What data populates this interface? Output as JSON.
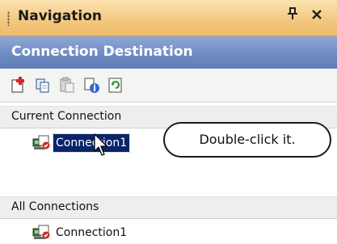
{
  "titlebar": {
    "title": "Navigation",
    "pin_icon": "⚲",
    "close_icon": "✕"
  },
  "destination_header": {
    "title": "Connection Destination"
  },
  "toolbar": {
    "icons": [
      "new-connection-icon",
      "copy-icon",
      "paste-icon",
      "properties-icon",
      "refresh-icon"
    ]
  },
  "current_connection": {
    "header": "Current Connection",
    "item": {
      "label": "Connection1",
      "selected": true,
      "icon": "connection-icon"
    }
  },
  "all_connections": {
    "header": "All Connections",
    "items": [
      {
        "label": "Connection1",
        "icon": "connection-icon"
      }
    ]
  },
  "callout": {
    "text": "Double-click it."
  },
  "colors": {
    "titlebar": "#f3c77e",
    "destination_header": "#6f8bc2",
    "selection": "#0a246a"
  }
}
